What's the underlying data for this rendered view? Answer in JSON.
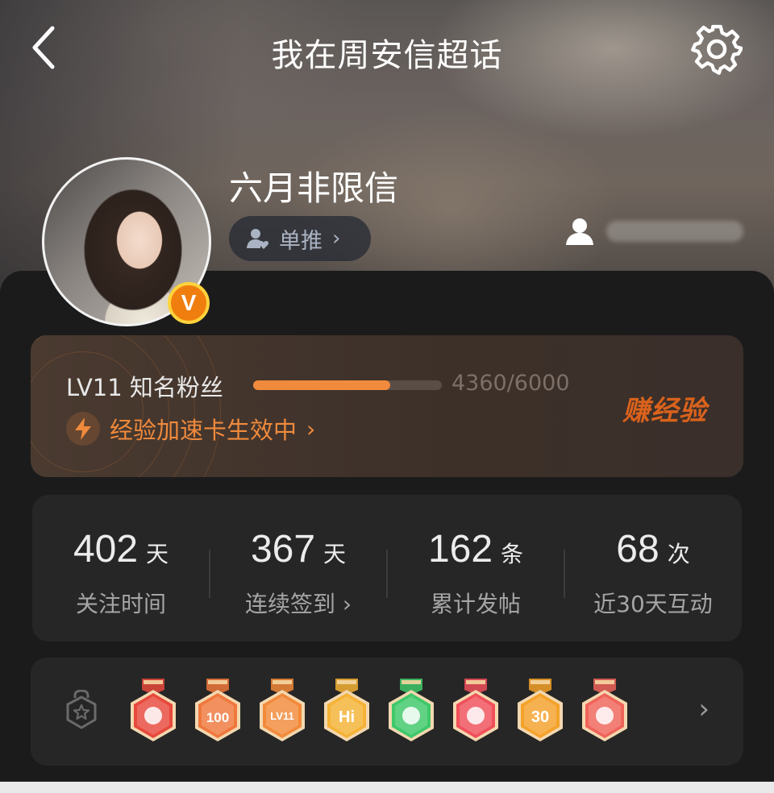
{
  "header": {
    "title": "我在周安信超话",
    "back_icon": "chevron-left-icon",
    "settings_icon": "gear-icon"
  },
  "profile": {
    "username": "六月非限信",
    "verified_mark": "V",
    "tag_label": "单推",
    "tag_icon": "person-heart-icon",
    "side_icon": "person-icon"
  },
  "level": {
    "level_text": "LV11 知名粉丝",
    "progress_text": "4360/6000",
    "progress_current": 4360,
    "progress_total": 6000,
    "boost_text": "经验加速卡生效中",
    "earn_label": "赚经验",
    "accent": "#f08a3c"
  },
  "stats": [
    {
      "value": "402",
      "unit": "天",
      "label": "关注时间"
    },
    {
      "value": "367",
      "unit": "天",
      "label": "连续签到 ›"
    },
    {
      "value": "162",
      "unit": "条",
      "label": "累计发帖"
    },
    {
      "value": "68",
      "unit": "次",
      "label": "近30天互动"
    }
  ],
  "badges": {
    "lock_icon": "badge-lock-icon",
    "items": [
      {
        "name": "mascot-badge",
        "text": "",
        "color": "#e8493c"
      },
      {
        "name": "100-days-badge",
        "text": "100",
        "color": "#f0783c"
      },
      {
        "name": "lv11-badge",
        "text": "LV11",
        "color": "#f28a3a"
      },
      {
        "name": "hi-badge",
        "text": "Hi",
        "color": "#f5b235"
      },
      {
        "name": "hand-badge",
        "text": "",
        "color": "#3fc86a"
      },
      {
        "name": "trophy-badge",
        "text": "",
        "color": "#f0505a"
      },
      {
        "name": "30-days-badge",
        "text": "30",
        "color": "#f5a22a"
      },
      {
        "name": "rock-hand-badge",
        "text": "",
        "color": "#f0645a"
      }
    ]
  }
}
